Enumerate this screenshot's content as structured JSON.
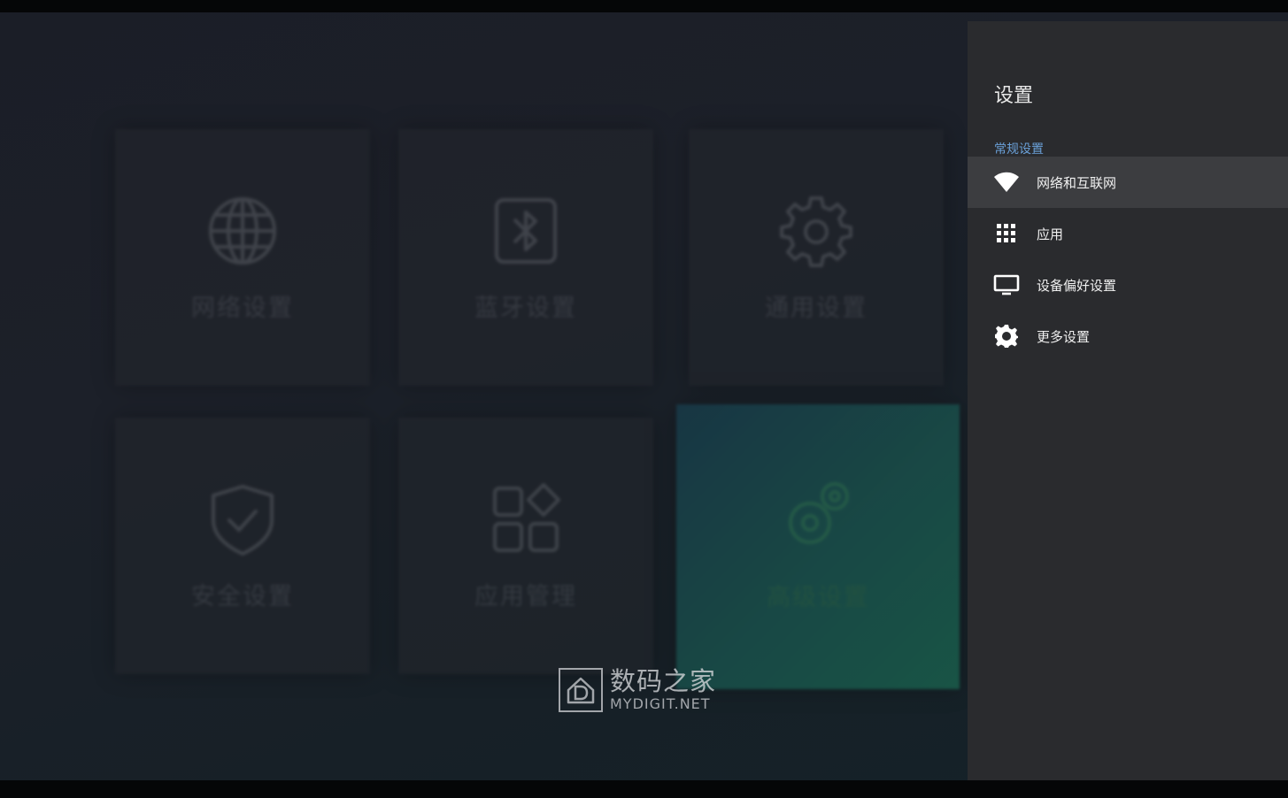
{
  "grid": {
    "tiles": [
      {
        "label": "网络设置",
        "icon": "globe-icon"
      },
      {
        "label": "蓝牙设置",
        "icon": "bluetooth-icon"
      },
      {
        "label": "通用设置",
        "icon": "gear-icon"
      },
      {
        "label": "安全设置",
        "icon": "shield-check-icon"
      },
      {
        "label": "应用管理",
        "icon": "apps-icon"
      },
      {
        "label": "高级设置",
        "icon": "gears-icon"
      }
    ],
    "active_index": 5
  },
  "panel": {
    "title": "设置",
    "section": "常规设置",
    "items": [
      {
        "label": "网络和互联网",
        "icon": "wifi-icon",
        "selected": true
      },
      {
        "label": "应用",
        "icon": "grid-icon",
        "selected": false
      },
      {
        "label": "设备偏好设置",
        "icon": "tv-icon",
        "selected": false
      },
      {
        "label": "更多设置",
        "icon": "gear-icon",
        "selected": false
      }
    ]
  },
  "watermark": {
    "cn": "数码之家",
    "en": "MYDIGIT.NET"
  },
  "colors": {
    "accent": "#6aa0d8",
    "active_tile": "#1a6a5e",
    "panel_bg": "#2a2b2e"
  }
}
